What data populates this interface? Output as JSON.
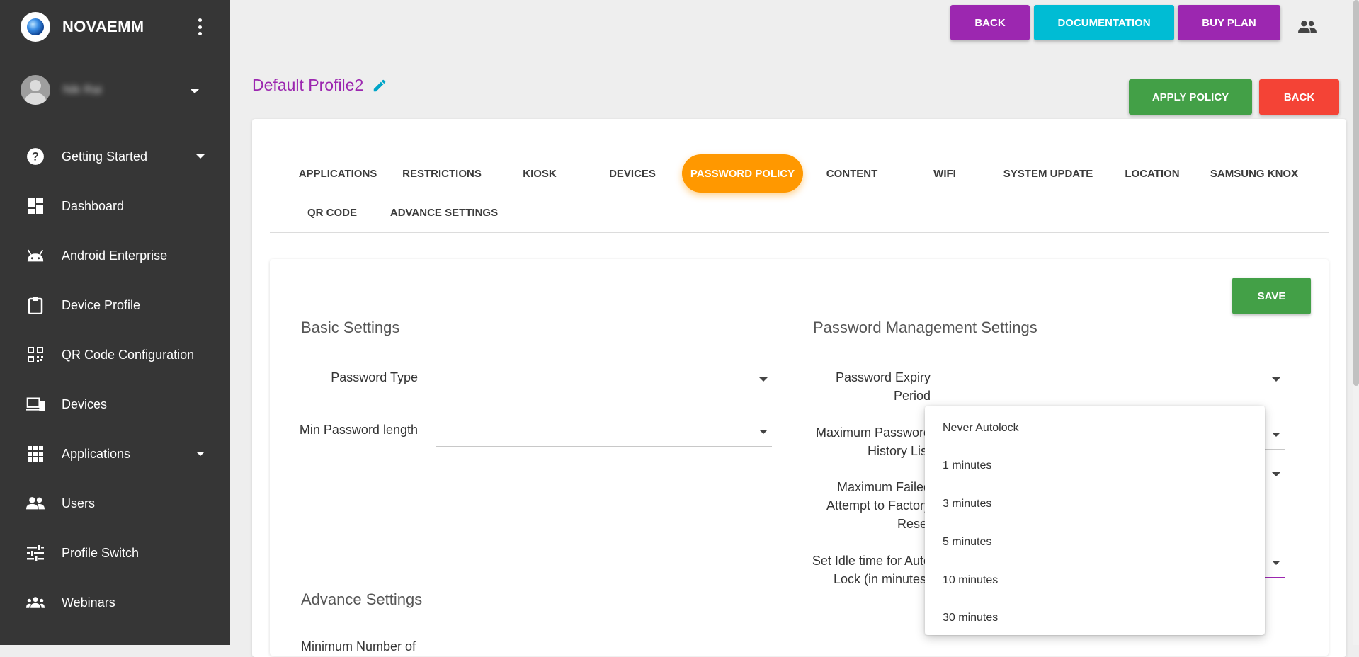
{
  "brand": {
    "name": "NOVAEMM"
  },
  "user": {
    "name": "Nik Rai"
  },
  "sidebar": {
    "items": [
      {
        "label": "Getting Started",
        "icon": "help-circle-icon"
      },
      {
        "label": "Dashboard",
        "icon": "dashboard-icon"
      },
      {
        "label": "Android Enterprise",
        "icon": "android-icon"
      },
      {
        "label": "Device Profile",
        "icon": "clipboard-icon"
      },
      {
        "label": "QR Code Configuration",
        "icon": "qr-code-icon"
      },
      {
        "label": "Devices",
        "icon": "devices-icon"
      },
      {
        "label": "Applications",
        "icon": "apps-grid-icon"
      },
      {
        "label": "Users",
        "icon": "users-icon"
      },
      {
        "label": "Profile Switch",
        "icon": "sliders-icon"
      },
      {
        "label": "Webinars",
        "icon": "group-icon"
      }
    ]
  },
  "topbar": {
    "back": "BACK",
    "documentation": "DOCUMENTATION",
    "buy_plan": "BUY PLAN"
  },
  "profile": {
    "title": "Default Profile2",
    "apply": "APPLY POLICY",
    "back": "BACK"
  },
  "tabs": [
    "APPLICATIONS",
    "RESTRICTIONS",
    "KIOSK",
    "DEVICES",
    "PASSWORD POLICY",
    "CONTENT",
    "WIFI",
    "SYSTEM UPDATE",
    "LOCATION",
    "SAMSUNG KNOX",
    "QR CODE",
    "ADVANCE SETTINGS"
  ],
  "active_tab": "PASSWORD POLICY",
  "form": {
    "save": "SAVE",
    "basic": {
      "heading": "Basic Settings",
      "password_type": "Password Type",
      "min_length": "Min Password length"
    },
    "mgmt": {
      "heading": "Password Management Settings",
      "expiry_1": "Password Expiry",
      "expiry_2": "Period",
      "history_1": "Maximum Password",
      "history_2": "History List",
      "failed_1": "Maximum Failed",
      "failed_2": "Attempt to Factory",
      "failed_3": "Reset",
      "idle_1": "Set Idle time for Auto",
      "idle_2": "Lock (in minutes)"
    },
    "advance": {
      "heading": "Advance Settings",
      "first_label": "Minimum Number of"
    }
  },
  "dropdown": {
    "options": [
      "Never Autolock",
      "1 minutes",
      "3 minutes",
      "5 minutes",
      "10 minutes",
      "30 minutes"
    ]
  },
  "colors": {
    "sidebar": "#363636",
    "purple": "#9c27b0",
    "cyan": "#00bcd4",
    "green": "#43a047",
    "red": "#f44336",
    "orange": "#ff9800"
  }
}
